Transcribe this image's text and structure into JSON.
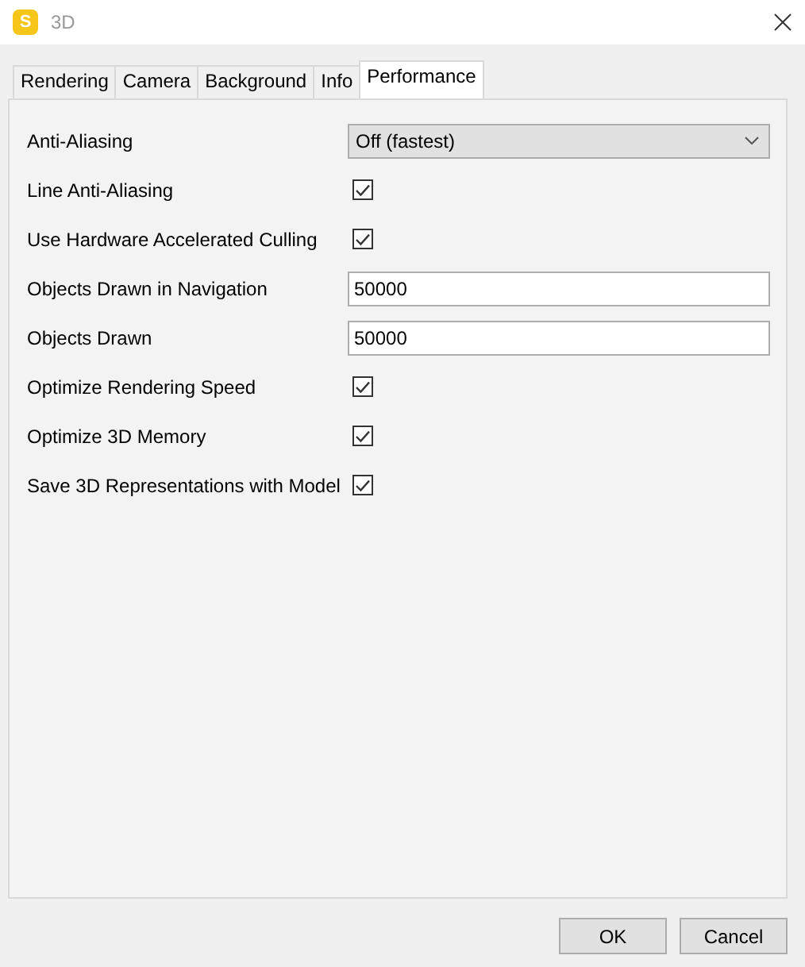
{
  "window": {
    "title": "3D",
    "app_badge": "S"
  },
  "tabs": [
    {
      "label": "Rendering",
      "selected": false
    },
    {
      "label": "Camera",
      "selected": false
    },
    {
      "label": "Background",
      "selected": false
    },
    {
      "label": "Info",
      "selected": false
    },
    {
      "label": "Performance",
      "selected": true
    }
  ],
  "settings": [
    {
      "kind": "dropdown",
      "label": "Anti-Aliasing",
      "value": "Off (fastest)"
    },
    {
      "kind": "checkbox",
      "label": "Line Anti-Aliasing",
      "checked": true
    },
    {
      "kind": "checkbox",
      "label": "Use Hardware Accelerated Culling",
      "checked": true
    },
    {
      "kind": "text",
      "label": "Objects Drawn in Navigation",
      "value": "50000"
    },
    {
      "kind": "text",
      "label": "Objects Drawn",
      "value": "50000"
    },
    {
      "kind": "checkbox",
      "label": "Optimize Rendering Speed",
      "checked": true
    },
    {
      "kind": "checkbox",
      "label": "Optimize 3D Memory",
      "checked": true
    },
    {
      "kind": "checkbox",
      "label": "Save 3D Representations with Model",
      "checked": true
    }
  ],
  "buttons": [
    "OK",
    "Cancel"
  ]
}
